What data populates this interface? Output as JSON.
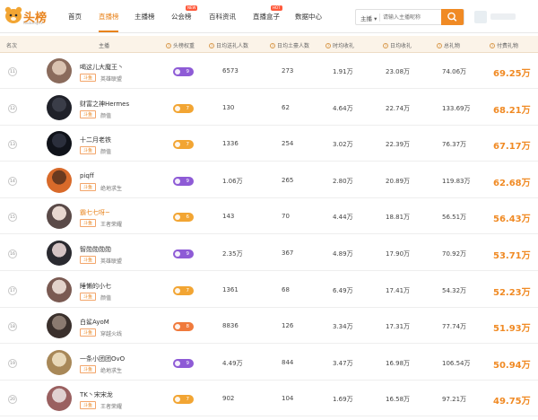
{
  "header": {
    "logo_text": "头榜",
    "logo_sub": "toubang.tv",
    "nav": [
      {
        "label": "首页",
        "active": false,
        "badge": ""
      },
      {
        "label": "直播榜",
        "active": true,
        "badge": ""
      },
      {
        "label": "主播榜",
        "active": false,
        "badge": ""
      },
      {
        "label": "公会榜",
        "active": false,
        "badge": "NEW"
      },
      {
        "label": "百科资讯",
        "active": false,
        "badge": ""
      },
      {
        "label": "直播盒子",
        "active": false,
        "badge": "HOT"
      },
      {
        "label": "数据中心",
        "active": false,
        "badge": ""
      }
    ],
    "search": {
      "select_label": "主播",
      "placeholder": "请输入主播昵称"
    }
  },
  "table": {
    "columns": [
      "名次",
      "主播",
      "头榜权重",
      "日均送礼人数",
      "日均土豪人数",
      "时均收礼",
      "日均收礼",
      "总礼物",
      "付费礼物"
    ],
    "rows": [
      {
        "rank": "11",
        "name": "喝这儿大魔王丶",
        "name_color": "#333333",
        "tag": "斗鱼",
        "group": "英雄联盟",
        "weight": "9",
        "weight_color": "#8e5bd6",
        "gift_users": "6573",
        "rich_users": "273",
        "hourly": "1.91万",
        "daily": "23.08万",
        "total": "74.06万",
        "paid": "69.25万"
      },
      {
        "rank": "12",
        "name": "财富之神Hermes",
        "name_color": "#333333",
        "tag": "斗鱼",
        "group": "颜值",
        "weight": "7",
        "weight_color": "#f2a533",
        "gift_users": "130",
        "rich_users": "62",
        "hourly": "4.64万",
        "daily": "22.74万",
        "total": "133.69万",
        "paid": "68.21万"
      },
      {
        "rank": "13",
        "name": "十二月老铁",
        "name_color": "#333333",
        "tag": "斗鱼",
        "group": "颜值",
        "weight": "7",
        "weight_color": "#f2a533",
        "gift_users": "1336",
        "rich_users": "254",
        "hourly": "3.02万",
        "daily": "22.39万",
        "total": "76.37万",
        "paid": "67.17万"
      },
      {
        "rank": "14",
        "name": "piqff",
        "name_color": "#333333",
        "tag": "斗鱼",
        "group": "绝地求生",
        "weight": "9",
        "weight_color": "#8e5bd6",
        "gift_users": "1.06万",
        "rich_users": "265",
        "hourly": "2.80万",
        "daily": "20.89万",
        "total": "119.83万",
        "paid": "62.68万"
      },
      {
        "rank": "15",
        "name": "霸七七呀~",
        "name_color": "#e8831c",
        "tag": "斗鱼",
        "group": "王者荣耀",
        "weight": "6",
        "weight_color": "#f2a533",
        "gift_users": "143",
        "rich_users": "70",
        "hourly": "4.44万",
        "daily": "18.81万",
        "total": "56.51万",
        "paid": "56.43万"
      },
      {
        "rank": "16",
        "name": "智勋勋勋勋",
        "name_color": "#333333",
        "tag": "斗鱼",
        "group": "英雄联盟",
        "weight": "9",
        "weight_color": "#8e5bd6",
        "gift_users": "2.35万",
        "rich_users": "367",
        "hourly": "4.89万",
        "daily": "17.90万",
        "total": "70.92万",
        "paid": "53.71万"
      },
      {
        "rank": "17",
        "name": "睡懒的小七",
        "name_color": "#333333",
        "tag": "斗鱼",
        "group": "颜值",
        "weight": "7",
        "weight_color": "#f2a533",
        "gift_users": "1361",
        "rich_users": "68",
        "hourly": "6.49万",
        "daily": "17.41万",
        "total": "54.32万",
        "paid": "52.23万"
      },
      {
        "rank": "18",
        "name": "白鲨AyoM",
        "name_color": "#333333",
        "tag": "斗鱼",
        "group": "穿越火线",
        "weight": "8",
        "weight_color": "#f07a3c",
        "gift_users": "8836",
        "rich_users": "126",
        "hourly": "3.34万",
        "daily": "17.31万",
        "total": "77.74万",
        "paid": "51.93万"
      },
      {
        "rank": "19",
        "name": "一条小团团OvO",
        "name_color": "#333333",
        "tag": "斗鱼",
        "group": "绝地求生",
        "weight": "9",
        "weight_color": "#8e5bd6",
        "gift_users": "4.49万",
        "rich_users": "844",
        "hourly": "3.47万",
        "daily": "16.98万",
        "total": "106.54万",
        "paid": "50.94万"
      },
      {
        "rank": "20",
        "name": "TK丶宋宋龙",
        "name_color": "#333333",
        "tag": "斗鱼",
        "group": "王者荣耀",
        "weight": "7",
        "weight_color": "#f2a533",
        "gift_users": "902",
        "rich_users": "104",
        "hourly": "1.69万",
        "daily": "16.58万",
        "total": "97.21万",
        "paid": "49.75万"
      }
    ]
  },
  "colors": {
    "accent": "#f08a24",
    "header_bg": "#fbf3e8"
  }
}
